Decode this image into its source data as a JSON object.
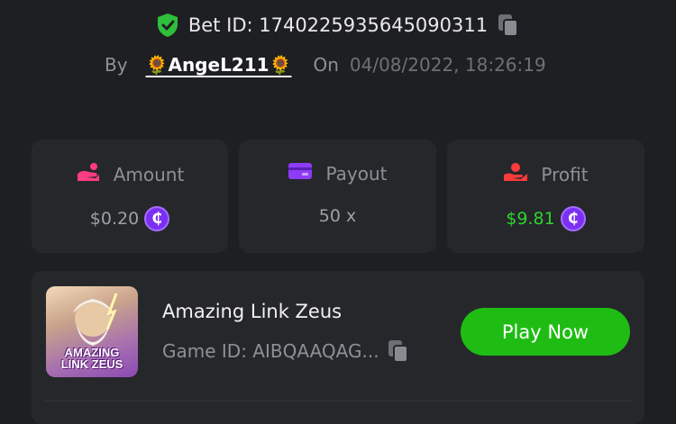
{
  "bet": {
    "id_label": "Bet ID: 1740225935645090311",
    "by_label": "By",
    "user_prefix_emoji": "🌻",
    "username": "AngeL211",
    "user_suffix_emoji": "🌻",
    "on_label": "On",
    "datetime": "04/08/2022, 18:26:19"
  },
  "stats": {
    "amount": {
      "label": "Amount",
      "value": "$0.20",
      "currency_symbol": "₵"
    },
    "payout": {
      "label": "Payout",
      "value": "50 x"
    },
    "profit": {
      "label": "Profit",
      "value": "$9.81",
      "currency_symbol": "₵"
    }
  },
  "game": {
    "name": "Amazing Link Zeus",
    "id_label": "Game ID: AIBQAAQAG...",
    "thumbnail_title_line1": "AMAZING",
    "thumbnail_title_line2": "LINK ZEUS",
    "play_label": "Play Now"
  },
  "colors": {
    "accent_green": "#1fbd14",
    "profit_green": "#2ed32e",
    "coin_purple": "#7b2ff2",
    "amount_icon_pink": "#ff3d7f",
    "payout_icon_purple": "#8e3cf7",
    "profit_icon_red": "#ff3b3b"
  },
  "icons": {
    "verified": "shield-check-icon",
    "copy": "copy-icon",
    "amount": "coin-hand-icon",
    "payout": "card-icon",
    "profit": "hand-coin-icon",
    "currency": "cent-coin-icon"
  }
}
